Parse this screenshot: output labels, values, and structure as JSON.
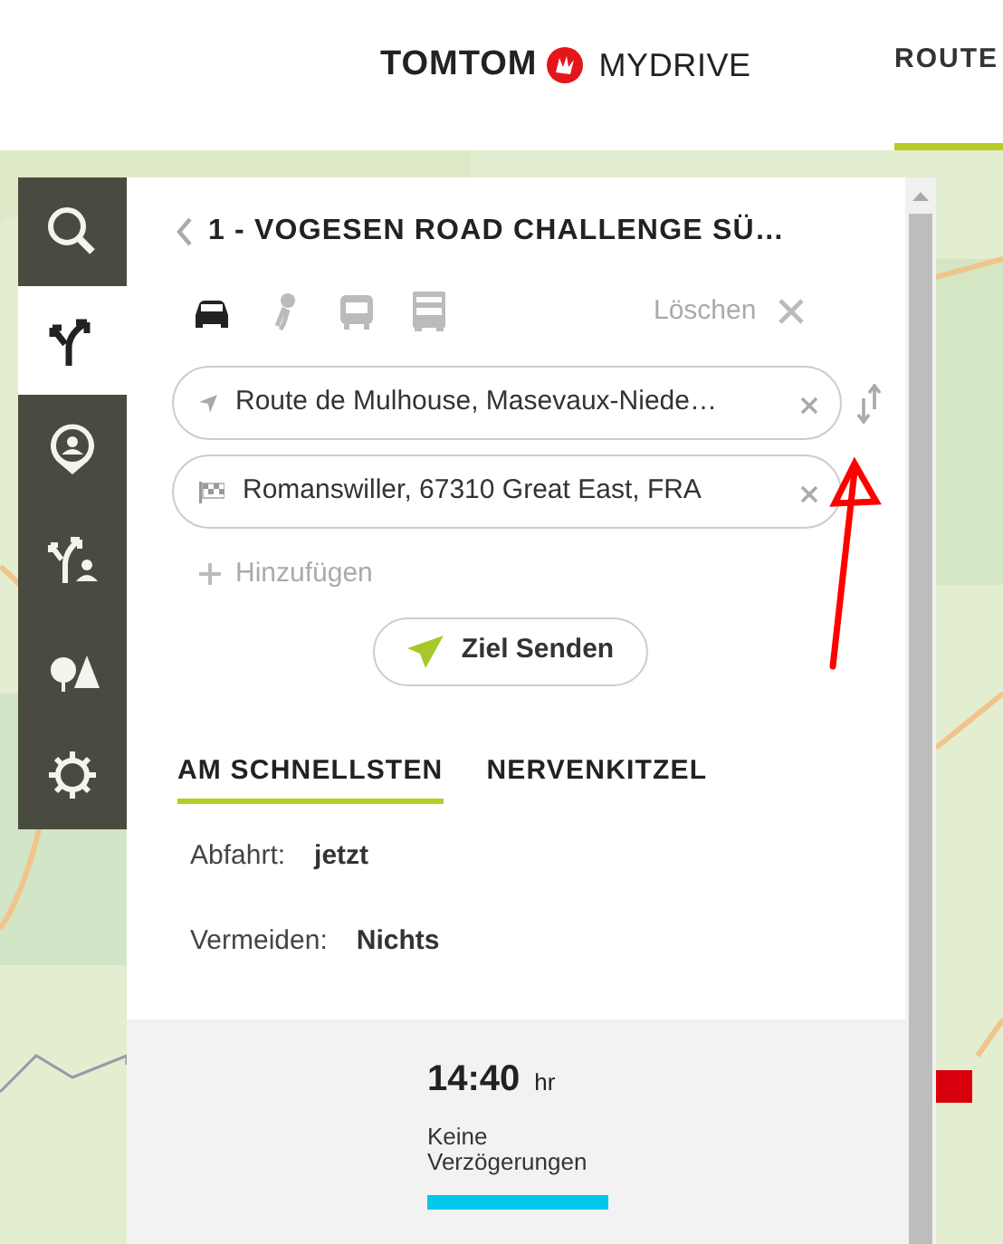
{
  "header": {
    "brand": "TOMTOM",
    "product": "MYDRIVE",
    "nav": [
      {
        "label": "ROUTE",
        "selected": true
      }
    ]
  },
  "sidebar": {
    "items": [
      {
        "kind": "search",
        "selected": false
      },
      {
        "kind": "route",
        "selected": true
      },
      {
        "kind": "places",
        "selected": false
      },
      {
        "kind": "shared",
        "selected": false
      },
      {
        "kind": "poi",
        "selected": false
      },
      {
        "kind": "settings",
        "selected": false
      }
    ]
  },
  "panel": {
    "title": "1 - VOGESEN ROAD CHALLENGE SÜ…",
    "modes": [
      {
        "kind": "car",
        "selected": true
      },
      {
        "kind": "motorcycle",
        "selected": false
      },
      {
        "kind": "bus",
        "selected": false
      },
      {
        "kind": "truck",
        "selected": false
      }
    ],
    "clear_label": "Löschen",
    "stops": [
      {
        "kind": "start",
        "value": "Route de Mulhouse, Masevaux-Niede…"
      },
      {
        "kind": "destination",
        "value": "Romanswiller, 67310 Great East, FRA"
      }
    ],
    "add_label": "Hinzufügen",
    "send_button": "Ziel Senden",
    "route_tabs": [
      {
        "label": "AM SCHNELLSTEN",
        "selected": true
      },
      {
        "label": "NERVENKITZEL",
        "selected": false
      }
    ],
    "details": [
      {
        "label": "Abfahrt:",
        "value": "jetzt"
      },
      {
        "label": "Vermeiden:",
        "value": "Nichts"
      }
    ],
    "summary": {
      "time": "14:40",
      "unit": "hr",
      "traffic": "Keine Verzögerungen"
    }
  }
}
